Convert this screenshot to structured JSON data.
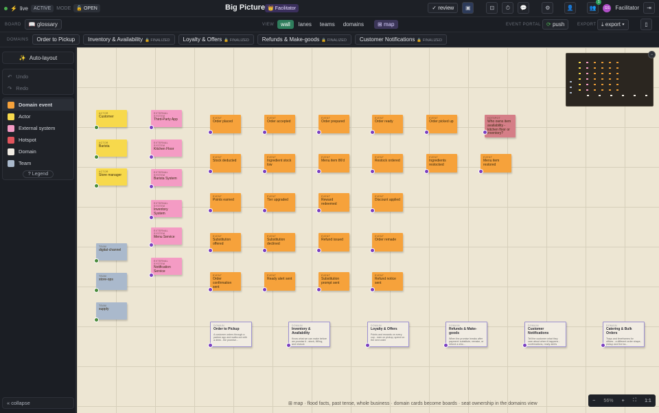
{
  "topbar": {
    "live": "live",
    "active": "ACTIVE",
    "mode_label": "MODE",
    "open": "OPEN",
    "title": "Big Picture",
    "role_badge": "Facilitator",
    "review": "✓ review",
    "notif_count": "1",
    "user_initials": "GS",
    "user_role": "Facilitator"
  },
  "toolbar": {
    "board_label": "BOARD",
    "glossary": "glossary",
    "view_label": "VIEW",
    "views": [
      "wall",
      "lanes",
      "teams",
      "domains"
    ],
    "map": "map",
    "portal_label": "EVENT PORTAL",
    "push": "push",
    "export_label": "EXPORT",
    "export": "export"
  },
  "domains_bar": {
    "label": "DOMAINS",
    "tabs": [
      {
        "name": "Order to Pickup",
        "finalized": ""
      },
      {
        "name": "Inventory & Availability",
        "finalized": "FINALIZED"
      },
      {
        "name": "Loyalty & Offers",
        "finalized": "FINALIZED"
      },
      {
        "name": "Refunds & Make-goods",
        "finalized": "FINALIZED"
      },
      {
        "name": "Customer Notifications",
        "finalized": "FINALIZED"
      }
    ]
  },
  "sidebar": {
    "autolayout": "Auto-layout",
    "undo": "Undo",
    "redo": "Redo",
    "legend_items": [
      {
        "label": "Domain event",
        "color": "#f6a23b"
      },
      {
        "label": "Actor",
        "color": "#f7d94c"
      },
      {
        "label": "External system",
        "color": "#f49bc4"
      },
      {
        "label": "Hotspot",
        "color": "#e2545c"
      },
      {
        "label": "Domain",
        "color": "#f1ece3"
      },
      {
        "label": "Team",
        "color": "#aab9cc"
      }
    ],
    "legend_btn": "? Legend",
    "collapse": "« collapse"
  },
  "canvas": {
    "actors": [
      {
        "kind": "ACTOR",
        "text": "Customer"
      },
      {
        "kind": "ACTOR",
        "text": "Barista"
      },
      {
        "kind": "ACTOR",
        "text": "Store manager"
      }
    ],
    "teams": [
      {
        "kind": "TEAM",
        "text": "digital-channel"
      },
      {
        "kind": "TEAM",
        "text": "store-ops"
      },
      {
        "kind": "TEAM",
        "text": "supply"
      }
    ],
    "externals": [
      {
        "kind": "EXTERNAL SYSTEM",
        "text": "Third-Party App"
      },
      {
        "kind": "EXTERNAL SYSTEM",
        "text": "Kitchen Floor"
      },
      {
        "kind": "EXTERNAL SYSTEM",
        "text": "Barista System"
      },
      {
        "kind": "EXTERNAL SYSTEM",
        "text": "Inventory System"
      },
      {
        "kind": "EXTERNAL SYSTEM",
        "text": "Menu Service"
      },
      {
        "kind": "EXTERNAL SYSTEM",
        "text": "Notification Service"
      }
    ],
    "events": [
      [
        "Order placed",
        "Order accepted",
        "Order prepared",
        "Order ready",
        "Order picked up"
      ],
      [
        "Stock deducted",
        "Ingredient stock low",
        "Menu item 86'd",
        "Restock ordered",
        "Ingredients restocked",
        "Menu item restored"
      ],
      [
        "Points earned",
        "Tier upgraded",
        "Reward redeemed",
        "Discount applied"
      ],
      [
        "Substitution offered",
        "Substitution declined",
        "Refund issued",
        "Order remade"
      ],
      [
        "Order confirmation sent",
        "Ready alert sent",
        "Substitution prompt sent",
        "Refund notice sent"
      ]
    ],
    "event_kind": "EVENT",
    "hotspot": {
      "kind": "HOTSPOT",
      "text": "Who owns item availability - kitchen floor or inventory?"
    },
    "domains": [
      {
        "kind": "DOMAIN",
        "title": "Order to Pickup",
        "desc": "A customer orders through a partner app and walks out with a drink - the promise..."
      },
      {
        "kind": "DOMAIN",
        "title": "Inventory & Availability",
        "desc": "Know what we can make before we promise it - stock, 86'ing, and restock"
      },
      {
        "kind": "DOMAIN",
        "title": "Loyalty & Offers",
        "desc": "Points and rewards on every cup - earn on pickup, spend on the next order"
      },
      {
        "kind": "DOMAIN",
        "title": "Refunds & Make-goods",
        "desc": "When the promise breaks after payment: substitute, remake, or refund a who..."
      },
      {
        "kind": "DOMAIN",
        "title": "Customer Notifications",
        "desc": "Tell the customer what they care about when it happens - confirmations, ready alerts"
      },
      {
        "kind": "DOMAIN",
        "title": "Catering & Bulk Orders",
        "desc": "Trays and timeframes for offices - a different order shape, pickup and the ba..."
      }
    ],
    "hint": "⊞ map · flood facts, past tense, whole business · domain cards become boards · seat ownership in the domains view",
    "zoom": {
      "minus": "−",
      "value": "56%",
      "plus": "+",
      "fit": "⛶",
      "one": "1:1"
    }
  }
}
